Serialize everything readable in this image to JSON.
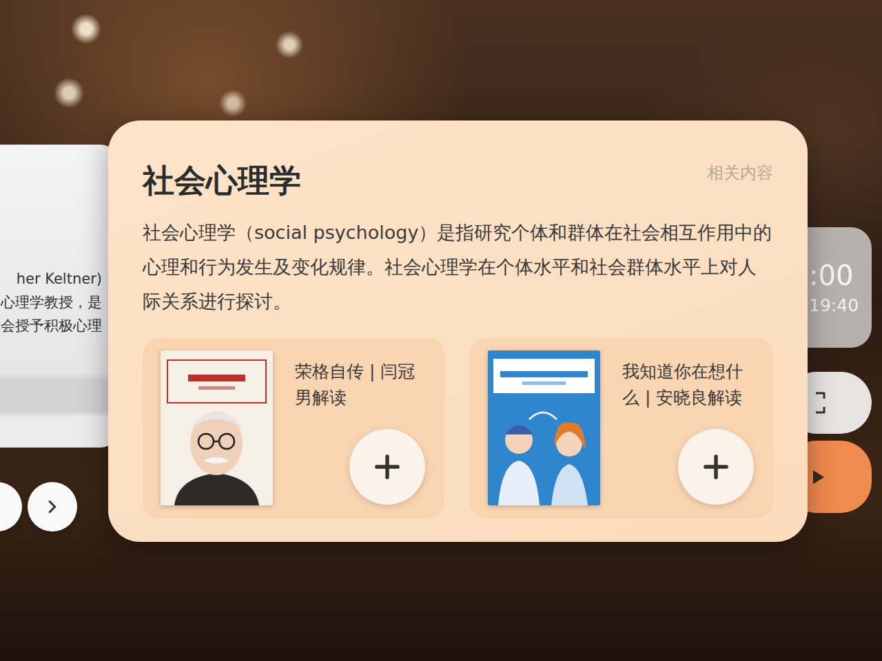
{
  "main_card": {
    "title": "社会心理学",
    "link": "相关内容",
    "description": "社会心理学（social psychology）是指研究个体和群体在社会相互作用中的心理和行为发生及变化规律。社会心理学在个体水平和社会群体水平上对人际关系进行探讨。",
    "books": [
      {
        "title": "荣格自传 | 闫冠男解读",
        "cover": "portrait"
      },
      {
        "title": "我知道你在想什么 | 安晓良解读",
        "cover": "couple"
      }
    ]
  },
  "left_panel": {
    "lines": [
      "her Keltner)",
      "心理学教授，是",
      "会授予积极心理"
    ]
  },
  "right_panel": {
    "time": ":00",
    "subtime": "19:40"
  }
}
